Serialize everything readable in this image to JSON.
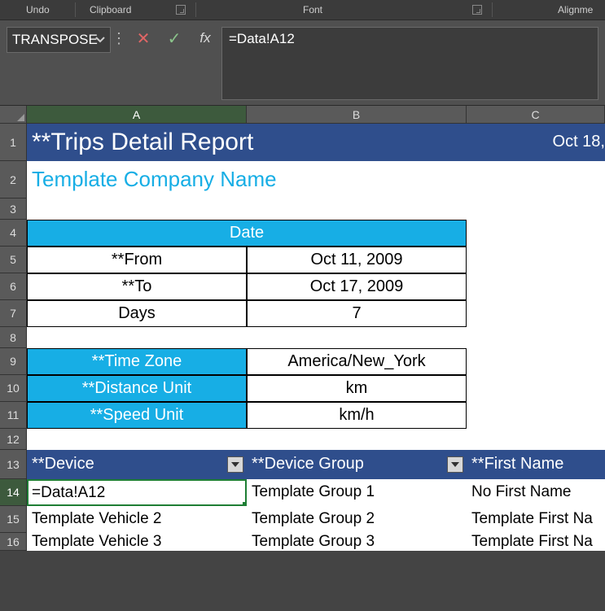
{
  "ribbon": {
    "undo": "Undo",
    "clipboard": "Clipboard",
    "font": "Font",
    "alignment": "Alignme"
  },
  "nameBox": {
    "value": "TRANSPOSE"
  },
  "formulaBar": {
    "value": "=Data!A12"
  },
  "columns": [
    "A",
    "B",
    "C"
  ],
  "rowNumbers": [
    "1",
    "2",
    "3",
    "4",
    "5",
    "6",
    "7",
    "8",
    "9",
    "10",
    "11",
    "12",
    "13",
    "14",
    "15",
    "16"
  ],
  "report": {
    "title": "**Trips Detail Report",
    "titleDate": "Oct 18,",
    "subtitle": "Template Company Name",
    "dateHeader": "Date",
    "fromLabel": "**From",
    "fromValue": "Oct 11, 2009",
    "toLabel": "**To",
    "toValue": "Oct 17, 2009",
    "daysLabel": "Days",
    "daysValue": "7",
    "tzLabel": "**Time Zone",
    "tzValue": "America/New_York",
    "distLabel": "**Distance Unit",
    "distValue": "km",
    "speedLabel": "**Speed Unit",
    "speedValue": "km/h"
  },
  "tableHeader": {
    "colA": "**Device",
    "colB": "**Device Group",
    "colC": "**First Name"
  },
  "tableRows": [
    {
      "a": "=Data!A12",
      "b": "Template Group 1",
      "c": "No First Name"
    },
    {
      "a": "Template Vehicle 2",
      "b": "Template Group 2",
      "c": "Template First Na"
    },
    {
      "a": "Template Vehicle 3",
      "b": "Template Group 3",
      "c": "Template First Na"
    }
  ]
}
